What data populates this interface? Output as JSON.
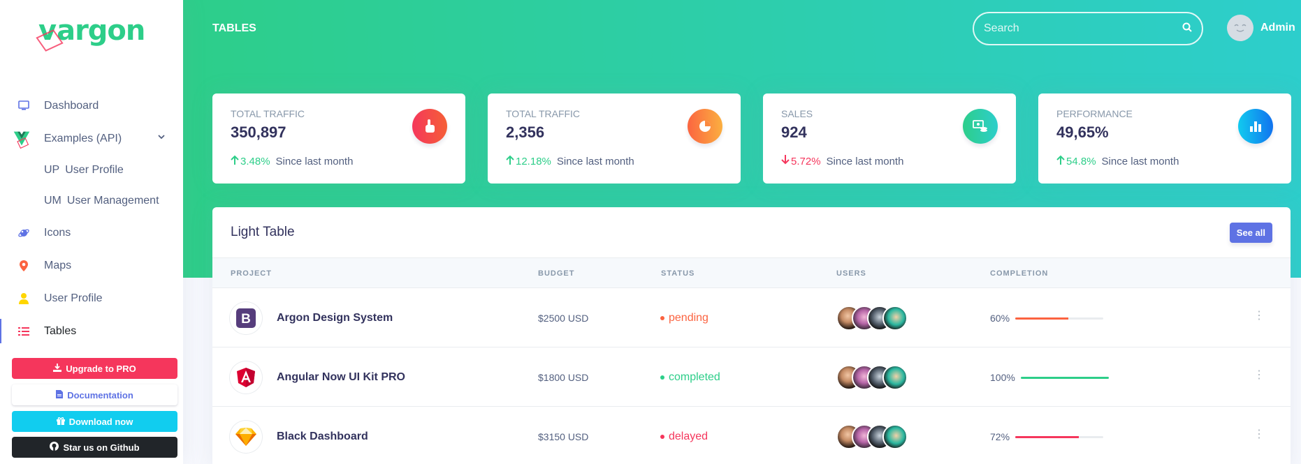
{
  "brand": {
    "v": "v",
    "word": "argon"
  },
  "colors": {
    "primary": "#5e72e4",
    "success": "#2dce89",
    "danger": "#f5365c",
    "warning": "#fb6340",
    "info": "#11cdef",
    "dark": "#212529"
  },
  "sidebar": {
    "items": [
      {
        "label": "Dashboard",
        "icon": "monitor-icon",
        "color": "#5e72e4"
      },
      {
        "label": "Examples (API)",
        "icon": "vue-logo-icon",
        "expandable": true
      },
      {
        "label": "Icons",
        "icon": "planet-icon",
        "color": "#5e72e4"
      },
      {
        "label": "Maps",
        "icon": "pin-icon",
        "color": "#fb6340"
      },
      {
        "label": "User Profile",
        "icon": "user-icon",
        "color": "#ffd600"
      },
      {
        "label": "Tables",
        "icon": "list-icon",
        "color": "#f5365c",
        "active": true
      }
    ],
    "sub_items": [
      {
        "abbr": "UP",
        "label": "User Profile"
      },
      {
        "abbr": "UM",
        "label": "User Management"
      }
    ],
    "buttons": {
      "upgrade": "Upgrade to PRO",
      "docs": "Documentation",
      "download": "Download now",
      "github": "Star us on Github"
    }
  },
  "header": {
    "title": "TABLES",
    "search_placeholder": "Search",
    "user_name": "Admin"
  },
  "stats": [
    {
      "label": "Total traffic",
      "value": "350,897",
      "delta": "3.48%",
      "direction": "up",
      "since": "Since last month",
      "icon": "hand-pointer-icon",
      "icon_bg": "linear-gradient(87deg,#f5365c,#f56036)"
    },
    {
      "label": "Total traffic",
      "value": "2,356",
      "delta": "12.18%",
      "direction": "up",
      "since": "Since last month",
      "icon": "pie-chart-icon",
      "icon_bg": "linear-gradient(87deg,#fb6340,#fbb140)"
    },
    {
      "label": "Sales",
      "value": "924",
      "delta": "5.72%",
      "direction": "down",
      "since": "Since last month",
      "icon": "money-coins-icon",
      "icon_bg": "linear-gradient(87deg,#2dce89,#2dcecc)"
    },
    {
      "label": "Performance",
      "value": "49,65%",
      "delta": "54.8%",
      "direction": "up",
      "since": "Since last month",
      "icon": "bar-chart-icon",
      "icon_bg": "linear-gradient(87deg,#11cdef,#1171ef)"
    }
  ],
  "table": {
    "title": "Light Table",
    "see_all": "See all",
    "columns": [
      "Project",
      "Budget",
      "Status",
      "Users",
      "Completion"
    ],
    "rows": [
      {
        "project": "Argon Design System",
        "logo": "bootstrap-logo-icon",
        "budget": "$2500 USD",
        "status": "pending",
        "status_color": "#fb6340",
        "completion": "60%",
        "completion_value": 0.6,
        "bar_color": "#fb6340"
      },
      {
        "project": "Angular Now UI Kit PRO",
        "logo": "angular-logo-icon",
        "budget": "$1800 USD",
        "status": "completed",
        "status_color": "#2dce89",
        "completion": "100%",
        "completion_value": 1.0,
        "bar_color": "#2dce89"
      },
      {
        "project": "Black Dashboard",
        "logo": "sketch-logo-icon",
        "budget": "$3150 USD",
        "status": "delayed",
        "status_color": "#f5365c",
        "completion": "72%",
        "completion_value": 0.72,
        "bar_color": "#f5365c"
      }
    ]
  }
}
